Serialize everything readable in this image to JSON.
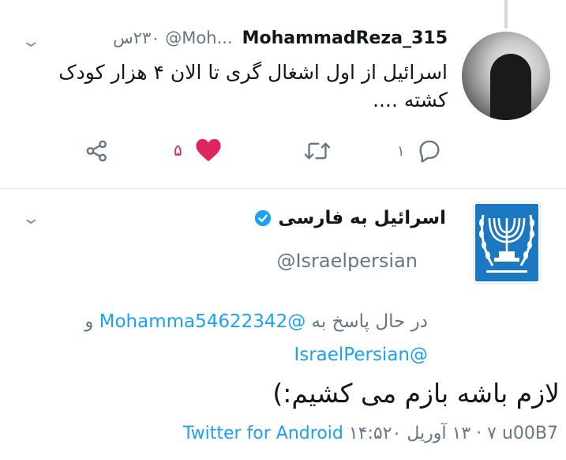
{
  "tweet1": {
    "display_name": "MohammadReza_315",
    "handle_and_time": "٢٣٠س @Moh...",
    "text": "اسرائیل از اول اشغال گری تا الان ۴ هزار کودک کشته ....",
    "actions": {
      "reply_count": "١",
      "like_count": "۵"
    }
  },
  "tweet2": {
    "display_name": "اسرائیل به فارسی",
    "handle": "@Israelpersian",
    "reply_prefix": "در حال پاسخ به",
    "reply_user1": "@Mohamma54622342",
    "reply_joiner": "و",
    "reply_user2": "@IsraelPersian",
    "text": "لازم باشه بازم می کشیم:)",
    "timestamp": "١۴:۵٧ · ١٣ آوریل ٢٠ u00B7",
    "source": "Twitter for Android"
  },
  "colors": {
    "accent": "#1da1f2",
    "like": "#e0245e",
    "muted": "#657786",
    "avatar_blue": "#1c78c0"
  },
  "icons": [
    "chevron-down-icon",
    "share-icon",
    "heart-icon",
    "retweet-icon",
    "reply-icon",
    "verified-icon"
  ]
}
